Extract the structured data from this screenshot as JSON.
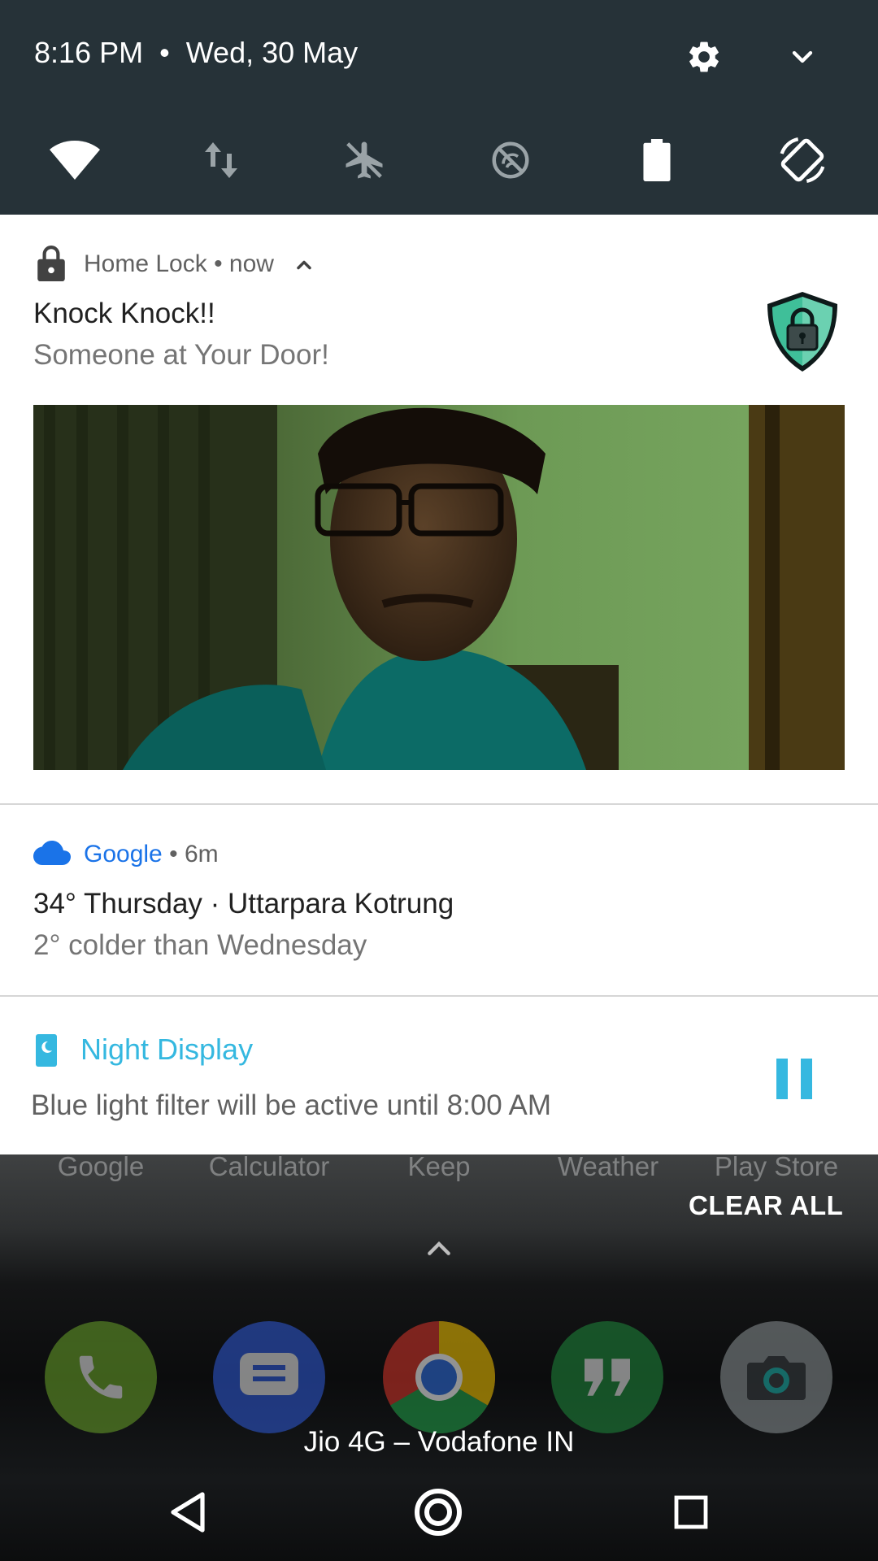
{
  "status": {
    "time": "8:16 PM",
    "separator": "•",
    "date": "Wed, 30 May"
  },
  "quick_settings": {
    "header_icons": [
      "gear-icon",
      "chevron-down-icon"
    ],
    "tiles": [
      "wifi-icon",
      "mobile-data-icon",
      "airplane-mode-off-icon",
      "do-not-disturb-icon",
      "battery-icon",
      "auto-rotate-icon"
    ]
  },
  "notifications": [
    {
      "app": "Home Lock",
      "sep": " • ",
      "time": "now",
      "title": "Knock Knock!!",
      "text": "Someone at Your Door!"
    },
    {
      "app": "Google",
      "sep": " • ",
      "time": "6m",
      "title": "34° Thursday · Uttarpara Kotrung",
      "text": "2° colder than Wednesday"
    },
    {
      "app": "Night Display",
      "text": "Blue light filter will be active until 8:00 AM"
    }
  ],
  "home": {
    "app_labels": [
      "Google",
      "Calculator",
      "Keep",
      "Weather",
      "Play Store"
    ],
    "clear_all": "CLEAR ALL",
    "dock": [
      "phone-icon",
      "messages-icon",
      "chrome-icon",
      "hangouts-icon",
      "camera-icon"
    ],
    "carrier": "Jio 4G – Vodafone IN"
  },
  "colors": {
    "qs_background": "#263238",
    "google_blue": "#1a73e8",
    "night_display_cyan": "#35b8e0",
    "shield_teal": "#3fbf99"
  }
}
